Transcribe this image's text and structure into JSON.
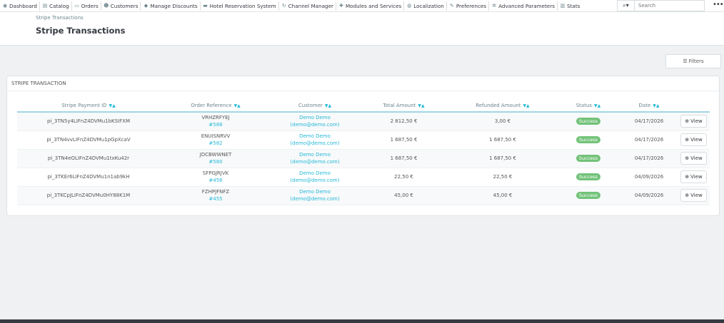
{
  "nav": {
    "items": [
      {
        "label": "Dashboard",
        "icon": "dashboard-icon",
        "glyph": "◉"
      },
      {
        "label": "Catalog",
        "icon": "catalog-icon",
        "glyph": "▤"
      },
      {
        "label": "Orders",
        "icon": "orders-icon",
        "glyph": "▭"
      },
      {
        "label": "Customers",
        "icon": "customers-icon",
        "glyph": "☻"
      },
      {
        "label": "Manage Discounts",
        "icon": "tag-icon",
        "glyph": "◆"
      },
      {
        "label": "Hotel Reservation System",
        "icon": "bed-icon",
        "glyph": "▬"
      },
      {
        "label": "Channel Manager",
        "icon": "refresh-icon",
        "glyph": "↻"
      },
      {
        "label": "Modules and Services",
        "icon": "puzzle-icon",
        "glyph": "✚"
      },
      {
        "label": "Localization",
        "icon": "globe-icon",
        "glyph": "◍"
      },
      {
        "label": "Preferences",
        "icon": "wrench-icon",
        "glyph": "✎"
      },
      {
        "label": "Advanced Parameters",
        "icon": "cogs-icon",
        "glyph": "✲"
      },
      {
        "label": "Stats",
        "icon": "bar-chart-icon",
        "glyph": "▥"
      }
    ],
    "search_placeholder": "Search",
    "search_icon": "search-icon",
    "more_glyph": "•••"
  },
  "header": {
    "breadcrumb": "Stripe Transactions",
    "title": "Stripe Transactions"
  },
  "filters_label": "Filters",
  "panel": {
    "heading": "STRIPE TRANSACTION",
    "columns": [
      "Stripe Payment ID",
      "Order Reference",
      "Customer",
      "Total Amount",
      "Refunded Amount",
      "Status",
      "Date"
    ],
    "sort_glyph": "▼▲",
    "view_label": "View",
    "rows": [
      {
        "payment_id": "pi_3TN5y4LIFnZ4DVMu1bKSIFXM",
        "order_ref": "VRHZRFYEJ",
        "order_id": "#588",
        "customer_name": "Demo Demo",
        "customer_email": "(demo@demo.com)",
        "total": "2 812,50 €",
        "refunded": "3,00 €",
        "status": "Success",
        "date": "04/17/2026"
      },
      {
        "payment_id": "pi_3TN4vvLIFnZ4DVMu1pGpXcaV",
        "order_ref": "ENUISNRVV",
        "order_id": "#582",
        "customer_name": "Demo Demo",
        "customer_email": "(demo@demo.com)",
        "total": "1 687,50 €",
        "refunded": "1 687,50 €",
        "status": "Success",
        "date": "04/17/2026"
      },
      {
        "payment_id": "pi_3TN4eOLIFnZ4DVMu1txKu42r",
        "order_ref": "JDCBWWNET",
        "order_id": "#580",
        "customer_name": "Demo Demo",
        "customer_email": "(demo@demo.com)",
        "total": "1 687,50 €",
        "refunded": "1 687,50 €",
        "status": "Success",
        "date": "04/17/2026"
      },
      {
        "payment_id": "pi_3TKEr6LIFnZ4DVMu1n1ab9kH",
        "order_ref": "SFPGJRJVK",
        "order_id": "#456",
        "customer_name": "Demo Demo",
        "customer_email": "(demo@demo.com)",
        "total": "22,50 €",
        "refunded": "22,50 €",
        "status": "Success",
        "date": "04/09/2026"
      },
      {
        "payment_id": "pi_3TKCpJLIFnZ4DVMu0HY88K1M",
        "order_ref": "FZHPJFNFZ",
        "order_id": "#455",
        "customer_name": "Demo Demo",
        "customer_email": "(demo@demo.com)",
        "total": "45,00 €",
        "refunded": "45,00 €",
        "status": "Success",
        "date": "04/09/2026"
      }
    ]
  },
  "colors": {
    "accent": "#25b9d7",
    "success": "#72c279",
    "text_dark": "#363a41"
  }
}
